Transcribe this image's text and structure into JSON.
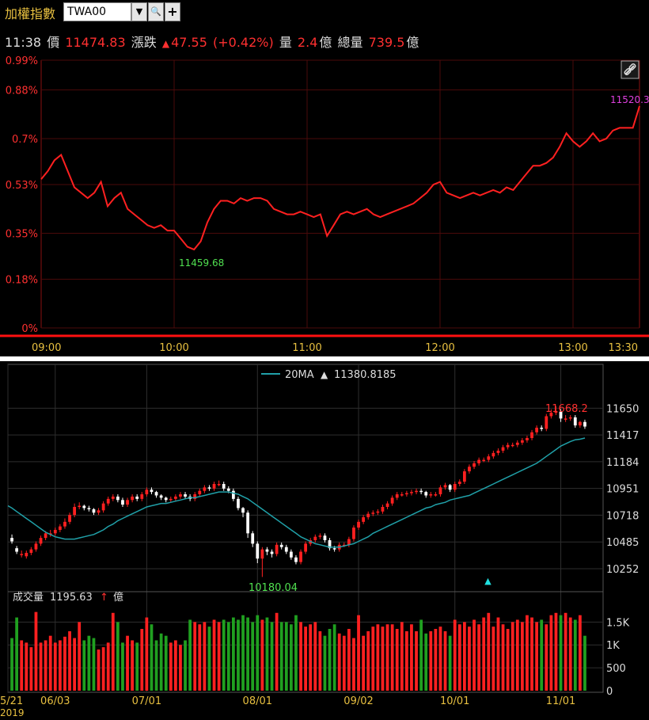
{
  "toolbar": {
    "title": "加權指數",
    "symbol": "TWA00",
    "dropdown_icon": "▼",
    "search_icon": "🔍",
    "add_icon": "+"
  },
  "quote": {
    "time": "11:38",
    "price_label": "價",
    "price": "11474.83",
    "change_label": "漲跌",
    "change_arrow": "▲",
    "change": "47.55",
    "change_pct": "(+0.42%)",
    "volume_label": "量",
    "volume": "2.4",
    "volume_unit": "億",
    "total_volume_label": "總量",
    "total_volume": "739.5",
    "total_volume_unit": "億"
  },
  "colors": {
    "up": "#ff2020",
    "down": "#20a020",
    "ma": "#20a0a8",
    "accent": "#e8c040"
  },
  "chart_data": [
    {
      "type": "line",
      "y_tick_labels": [
        "0.99%",
        "0.88%",
        "0.7%",
        "0.53%",
        "0.35%",
        "0.18%",
        "0%"
      ],
      "y_ticks": [
        0.99,
        0.88,
        0.7,
        0.53,
        0.35,
        0.18,
        0
      ],
      "ylim": [
        0,
        0.99
      ],
      "x_tick_labels": [
        "09:00",
        "10:00",
        "11:00",
        "12:00",
        "13:00",
        "13:30"
      ],
      "x_ticks_min": [
        0,
        60,
        120,
        180,
        240,
        270
      ],
      "xlim_min": [
        0,
        270
      ],
      "annotations": {
        "high": "11520.3",
        "low": "11459.68"
      },
      "grid": true,
      "series": [
        {
          "x_min": [
            0,
            3,
            6,
            9,
            12,
            15,
            18,
            21,
            24,
            27,
            30,
            33,
            36,
            39,
            42,
            45,
            48,
            51,
            54,
            57,
            60,
            63,
            66,
            69,
            72,
            75,
            78,
            81,
            84,
            87,
            90,
            93,
            96,
            99,
            102,
            105,
            108,
            111,
            114,
            117,
            120,
            123,
            126,
            129,
            132,
            135,
            138,
            141,
            144,
            147,
            150,
            153,
            156,
            159,
            162,
            165,
            168,
            171,
            174,
            177,
            180,
            183,
            186,
            189,
            192,
            195,
            198,
            201,
            204,
            207,
            210,
            213,
            216,
            219,
            222,
            225,
            228,
            231,
            234,
            237,
            240,
            243,
            246,
            249,
            252,
            255,
            258,
            261,
            264,
            267,
            270
          ],
          "values": [
            0.55,
            0.58,
            0.62,
            0.64,
            0.58,
            0.52,
            0.5,
            0.48,
            0.5,
            0.54,
            0.45,
            0.48,
            0.5,
            0.44,
            0.42,
            0.4,
            0.38,
            0.37,
            0.38,
            0.36,
            0.36,
            0.33,
            0.3,
            0.29,
            0.32,
            0.39,
            0.44,
            0.47,
            0.47,
            0.46,
            0.48,
            0.47,
            0.48,
            0.48,
            0.47,
            0.44,
            0.43,
            0.42,
            0.42,
            0.43,
            0.42,
            0.41,
            0.42,
            0.34,
            0.38,
            0.42,
            0.43,
            0.42,
            0.43,
            0.44,
            0.42,
            0.41,
            0.42,
            0.43,
            0.44,
            0.45,
            0.46,
            0.48,
            0.5,
            0.53,
            0.54,
            0.5,
            0.49,
            0.48,
            0.49,
            0.5,
            0.49,
            0.5,
            0.51,
            0.5,
            0.52,
            0.51,
            0.54,
            0.57,
            0.6,
            0.6,
            0.61,
            0.63,
            0.67,
            0.72,
            0.69,
            0.67,
            0.69,
            0.72,
            0.69,
            0.7,
            0.73,
            0.74,
            0.74,
            0.74,
            0.82
          ]
        }
      ]
    },
    {
      "type": "candlestick",
      "legend": {
        "name": "20MA",
        "arrow": "▲",
        "value": "11380.8185"
      },
      "y_tick_labels": [
        "11650",
        "11417",
        "11184",
        "10951",
        "10718",
        "10485",
        "10252"
      ],
      "y_ticks": [
        11650,
        11417,
        11184,
        10951,
        10718,
        10485,
        10252
      ],
      "ylim": [
        10100,
        11880
      ],
      "x_tick_labels": [
        "5/21",
        "06/03",
        "07/01",
        "08/01",
        "09/02",
        "10/01",
        "11/01"
      ],
      "x_tick_index": [
        0,
        9,
        28,
        51,
        72,
        92,
        114
      ],
      "year_label": "2019",
      "annotations": {
        "high": "11668.2",
        "low": "10180.04"
      },
      "grid": true,
      "dates": [
        "05/21",
        "05/22",
        "05/23",
        "05/24",
        "05/27",
        "05/28",
        "05/29",
        "05/30",
        "05/31",
        "06/03",
        "06/04",
        "06/05",
        "06/06",
        "06/10",
        "06/11",
        "06/12",
        "06/13",
        "06/14",
        "06/17",
        "06/18",
        "06/19",
        "06/20",
        "06/21",
        "06/24",
        "06/25",
        "06/26",
        "06/27",
        "06/28",
        "07/01",
        "07/02",
        "07/03",
        "07/04",
        "07/05",
        "07/08",
        "07/09",
        "07/10",
        "07/11",
        "07/12",
        "07/15",
        "07/16",
        "07/17",
        "07/18",
        "07/19",
        "07/22",
        "07/23",
        "07/24",
        "07/25",
        "07/26",
        "07/29",
        "07/30",
        "07/31",
        "08/01",
        "08/02",
        "08/05",
        "08/06",
        "08/07",
        "08/08",
        "08/12",
        "08/13",
        "08/14",
        "08/15",
        "08/16",
        "08/19",
        "08/20",
        "08/21",
        "08/22",
        "08/23",
        "08/26",
        "08/27",
        "08/28",
        "08/29",
        "08/30",
        "09/02",
        "09/03",
        "09/04",
        "09/05",
        "09/06",
        "09/09",
        "09/10",
        "09/11",
        "09/12",
        "09/16",
        "09/17",
        "09/18",
        "09/19",
        "09/20",
        "09/23",
        "09/24",
        "09/25",
        "09/26",
        "09/27",
        "09/30",
        "10/01",
        "10/02",
        "10/03",
        "10/04",
        "10/07",
        "10/08",
        "10/09",
        "10/14",
        "10/15",
        "10/16",
        "10/17",
        "10/18",
        "10/21",
        "10/22",
        "10/23",
        "10/24",
        "10/25",
        "10/28",
        "10/29",
        "10/30",
        "10/31",
        "11/01",
        "11/04",
        "11/05",
        "11/06",
        "11/07",
        "11/08",
        "11/11"
      ],
      "open": [
        10520,
        10430,
        10380,
        10360,
        10390,
        10420,
        10470,
        10520,
        10560,
        10560,
        10590,
        10620,
        10660,
        10720,
        10790,
        10800,
        10780,
        10770,
        10740,
        10760,
        10820,
        10860,
        10880,
        10850,
        10810,
        10850,
        10880,
        10860,
        10900,
        10940,
        10920,
        10890,
        10870,
        10850,
        10860,
        10880,
        10900,
        10880,
        10860,
        10900,
        10930,
        10960,
        10950,
        10990,
        10990,
        10950,
        10930,
        10860,
        10780,
        10740,
        10560,
        10470,
        10340,
        10420,
        10400,
        10380,
        10460,
        10440,
        10400,
        10350,
        10310,
        10400,
        10470,
        10500,
        10530,
        10540,
        10500,
        10430,
        10420,
        10460,
        10460,
        10510,
        10610,
        10660,
        10700,
        10730,
        10740,
        10750,
        10790,
        10820,
        10870,
        10900,
        10900,
        10910,
        10920,
        10930,
        10920,
        10890,
        10900,
        10900,
        10960,
        10980,
        10940,
        10990,
        11010,
        11100,
        11140,
        11170,
        11200,
        11200,
        11230,
        11260,
        11280,
        11310,
        11330,
        11330,
        11350,
        11370,
        11390,
        11440,
        11480,
        11470,
        11580,
        11610,
        11620,
        11560,
        11560,
        11570,
        11500,
        11530
      ],
      "close": [
        10490,
        10400,
        10380,
        10390,
        10420,
        10470,
        10520,
        10560,
        10560,
        10590,
        10620,
        10660,
        10720,
        10790,
        10800,
        10780,
        10770,
        10740,
        10760,
        10820,
        10860,
        10880,
        10850,
        10810,
        10850,
        10880,
        10860,
        10900,
        10940,
        10920,
        10890,
        10870,
        10850,
        10860,
        10880,
        10900,
        10880,
        10860,
        10900,
        10930,
        10960,
        10950,
        10990,
        10990,
        10950,
        10930,
        10860,
        10780,
        10740,
        10560,
        10470,
        10340,
        10420,
        10400,
        10380,
        10460,
        10440,
        10400,
        10350,
        10310,
        10400,
        10470,
        10500,
        10530,
        10540,
        10500,
        10430,
        10420,
        10460,
        10460,
        10510,
        10610,
        10660,
        10700,
        10730,
        10740,
        10750,
        10790,
        10820,
        10870,
        10900,
        10900,
        10910,
        10920,
        10930,
        10920,
        10890,
        10900,
        10900,
        10960,
        10980,
        10940,
        10990,
        11010,
        11100,
        11140,
        11170,
        11200,
        11200,
        11230,
        11260,
        11280,
        11310,
        11330,
        11330,
        11350,
        11370,
        11390,
        11440,
        11480,
        11470,
        11580,
        11610,
        11620,
        11560,
        11560,
        11570,
        11500,
        11530,
        11490
      ],
      "high": [
        10550,
        10450,
        10410,
        10410,
        10440,
        10490,
        10540,
        10580,
        10590,
        10610,
        10640,
        10690,
        10740,
        10820,
        10830,
        10810,
        10800,
        10780,
        10780,
        10840,
        10880,
        10900,
        10900,
        10870,
        10870,
        10900,
        10900,
        10920,
        10960,
        10960,
        10930,
        10900,
        10880,
        10880,
        10900,
        10920,
        10920,
        10900,
        10920,
        10950,
        10980,
        10980,
        11010,
        11020,
        11010,
        10970,
        10950,
        10880,
        10790,
        10760,
        10580,
        10490,
        10440,
        10440,
        10420,
        10480,
        10480,
        10460,
        10420,
        10370,
        10420,
        10490,
        10520,
        10550,
        10560,
        10560,
        10520,
        10450,
        10480,
        10480,
        10530,
        10630,
        10680,
        10720,
        10750,
        10760,
        10770,
        10810,
        10840,
        10890,
        10920,
        10920,
        10930,
        10940,
        10950,
        10950,
        10930,
        10920,
        10920,
        10980,
        11000,
        10990,
        11010,
        11030,
        11120,
        11160,
        11190,
        11220,
        11220,
        11250,
        11280,
        11300,
        11330,
        11350,
        11350,
        11370,
        11390,
        11410,
        11460,
        11500,
        11500,
        11600,
        11640,
        11668,
        11640,
        11590,
        11590,
        11590,
        11540,
        11550
      ],
      "low": [
        10470,
        10380,
        10350,
        10340,
        10370,
        10400,
        10450,
        10500,
        10530,
        10540,
        10570,
        10600,
        10640,
        10700,
        10770,
        10760,
        10750,
        10720,
        10720,
        10740,
        10800,
        10840,
        10830,
        10790,
        10790,
        10830,
        10840,
        10840,
        10880,
        10900,
        10870,
        10850,
        10830,
        10830,
        10840,
        10860,
        10860,
        10840,
        10840,
        10880,
        10910,
        10930,
        10930,
        10970,
        10930,
        10910,
        10840,
        10760,
        10700,
        10520,
        10440,
        10300,
        10180,
        10370,
        10350,
        10360,
        10420,
        10380,
        10330,
        10290,
        10290,
        10380,
        10450,
        10480,
        10510,
        10480,
        10410,
        10400,
        10400,
        10440,
        10440,
        10490,
        10590,
        10640,
        10680,
        10710,
        10720,
        10730,
        10770,
        10800,
        10850,
        10880,
        10880,
        10890,
        10900,
        10900,
        10870,
        10870,
        10880,
        10880,
        10940,
        10920,
        10920,
        10970,
        10990,
        11080,
        11120,
        11150,
        11180,
        11180,
        11210,
        11240,
        11260,
        11290,
        11310,
        11310,
        11330,
        11350,
        11370,
        11420,
        11450,
        11450,
        11560,
        11590,
        11530,
        11530,
        11540,
        11480,
        11480,
        11470
      ],
      "ma20": [
        10780,
        10750,
        10720,
        10690,
        10660,
        10630,
        10600,
        10570,
        10550,
        10530,
        10520,
        10510,
        10510,
        10510,
        10520,
        10530,
        10540,
        10550,
        10570,
        10590,
        10620,
        10640,
        10670,
        10690,
        10710,
        10730,
        10750,
        10770,
        10790,
        10800,
        10810,
        10820,
        10820,
        10830,
        10840,
        10850,
        10860,
        10870,
        10870,
        10880,
        10890,
        10900,
        10910,
        10920,
        10920,
        10920,
        10910,
        10900,
        10880,
        10860,
        10830,
        10800,
        10770,
        10740,
        10710,
        10680,
        10650,
        10620,
        10590,
        10560,
        10530,
        10510,
        10490,
        10470,
        10460,
        10450,
        10440,
        10440,
        10440,
        10450,
        10460,
        10470,
        10490,
        10510,
        10530,
        10560,
        10580,
        10600,
        10620,
        10640,
        10660,
        10680,
        10700,
        10720,
        10740,
        10760,
        10780,
        10790,
        10810,
        10820,
        10830,
        10850,
        10860,
        10870,
        10880,
        10890,
        10910,
        10930,
        10950,
        10970,
        10990,
        11010,
        11030,
        11050,
        11070,
        11090,
        11110,
        11130,
        11150,
        11170,
        11200,
        11230,
        11260,
        11290,
        11320,
        11340,
        11360,
        11375,
        11380,
        11390
      ],
      "volume": [
        1150,
        1600,
        1100,
        1050,
        950,
        1720,
        1050,
        1100,
        1200,
        1050,
        1100,
        1180,
        1300,
        1150,
        1500,
        1100,
        1200,
        1150,
        900,
        950,
        1050,
        1700,
        1500,
        1050,
        1200,
        1100,
        1050,
        1350,
        1600,
        1450,
        1100,
        1250,
        1200,
        1050,
        1100,
        1000,
        1100,
        1550,
        1500,
        1450,
        1500,
        1400,
        1550,
        1500,
        1550,
        1500,
        1600,
        1550,
        1650,
        1600,
        1500,
        1650,
        1550,
        1600,
        1500,
        1700,
        1500,
        1500,
        1450,
        1650,
        1500,
        1400,
        1450,
        1500,
        1300,
        1200,
        1350,
        1450,
        1250,
        1200,
        1350,
        1150,
        1650,
        1200,
        1300,
        1400,
        1450,
        1400,
        1450,
        1450,
        1350,
        1500,
        1300,
        1450,
        1300,
        1550,
        1250,
        1300,
        1350,
        1400,
        1300,
        1200,
        1550,
        1450,
        1500,
        1400,
        1550,
        1450,
        1600,
        1700,
        1400,
        1600,
        1450,
        1350,
        1500,
        1550,
        1500,
        1650,
        1600,
        1500,
        1550,
        1450,
        1650,
        1700,
        1650,
        1700,
        1600,
        1550,
        1650,
        1200
      ],
      "volume_tick_labels": [
        "1.5K",
        "1K",
        "500",
        "0"
      ],
      "volume_ticks": [
        1500,
        1000,
        500,
        0
      ],
      "volume_ylim": [
        0,
        1800
      ],
      "volume_title": "成交量",
      "volume_value": "1195.63",
      "volume_arrow": "↑",
      "volume_unit": "億",
      "marker_index": 99,
      "marker_glyph": "▲"
    }
  ]
}
